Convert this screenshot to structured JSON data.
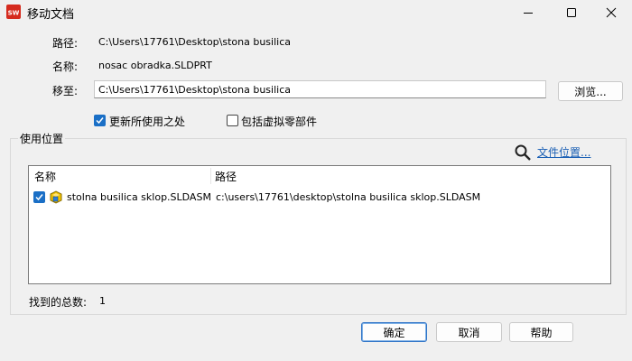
{
  "window": {
    "title": "移动文档",
    "app_icon": "solidworks-icon",
    "controls": [
      "minimize",
      "maximize",
      "close"
    ]
  },
  "form": {
    "path_label": "路径:",
    "path_value": "C:\\Users\\17761\\Desktop\\stona busilica",
    "name_label": "名称:",
    "name_value": "nosac obradka.SLDPRT",
    "move_to_label": "移至:",
    "move_to_value": "C:\\Users\\17761\\Desktop\\stona busilica",
    "browse_label": "浏览...",
    "update_usages_label": "更新所使用之处",
    "update_usages_checked": true,
    "include_virtual_label": "包括虚拟零部件",
    "include_virtual_checked": false
  },
  "usage_group": {
    "legend": "使用位置",
    "file_location_link": "文件位置...",
    "columns": [
      "名称",
      "路径"
    ],
    "rows": [
      {
        "checked": true,
        "icon": "assembly-icon",
        "name": "stolna busilica sklop.SLDASM",
        "path": "c:\\users\\17761\\desktop\\stolna busilica sklop.SLDASM"
      }
    ],
    "total_label": "找到的总数:",
    "total_value": "1"
  },
  "buttons": {
    "ok": "确定",
    "cancel": "取消",
    "help": "帮助"
  },
  "colors": {
    "accent": "#1a6fc6",
    "link": "#1a5fb4",
    "background": "#f0f0f0"
  }
}
